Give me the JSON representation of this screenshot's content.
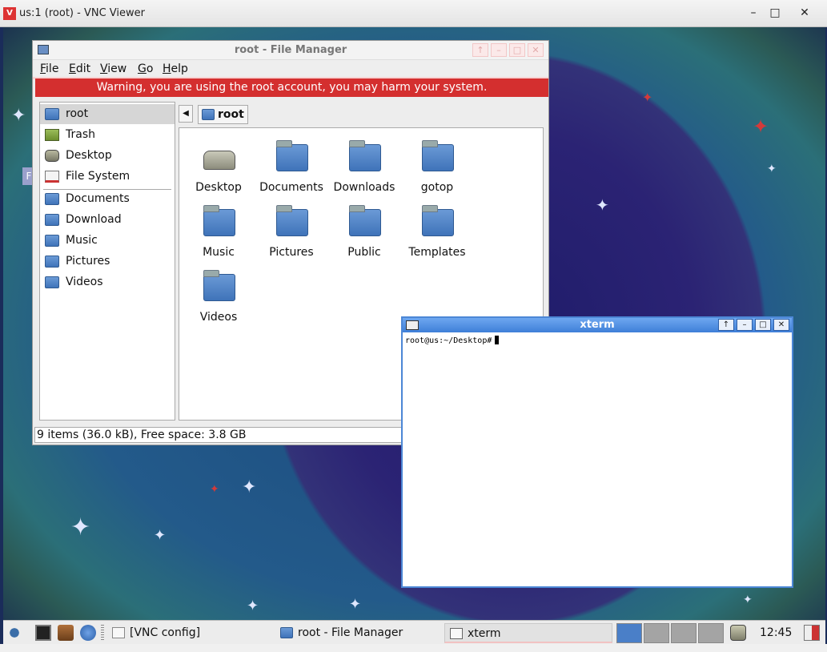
{
  "vnc": {
    "title": "us:1 (root) - VNC Viewer",
    "minimize": "–",
    "maximize": "□",
    "close": "✕"
  },
  "desktop": {
    "edge_tab_label": "F"
  },
  "file_manager": {
    "title": "root - File Manager",
    "buttons": {
      "up": "↑",
      "minimize": "–",
      "maximize": "□",
      "close": "✕"
    },
    "menu": [
      {
        "label": "File",
        "mnemonic": "F",
        "rest": "ile"
      },
      {
        "label": "Edit",
        "mnemonic": "E",
        "rest": "dit"
      },
      {
        "label": "View",
        "mnemonic": "V",
        "rest": "iew"
      },
      {
        "label": "Go",
        "mnemonic": "G",
        "rest": "o"
      },
      {
        "label": "Help",
        "mnemonic": "H",
        "rest": "elp"
      }
    ],
    "warning": "Warning, you are using the root account, you may harm your system.",
    "sidebar": {
      "places": [
        {
          "label": "root",
          "icon": "home-folder-icon",
          "selected": true
        },
        {
          "label": "Trash",
          "icon": "trash-icon",
          "selected": false
        },
        {
          "label": "Desktop",
          "icon": "desktop-icon",
          "selected": false
        },
        {
          "label": "File System",
          "icon": "drive-icon",
          "selected": false
        }
      ],
      "bookmarks": [
        {
          "label": "Documents",
          "icon": "folder-icon"
        },
        {
          "label": "Download",
          "icon": "folder-icon"
        },
        {
          "label": "Music",
          "icon": "folder-icon"
        },
        {
          "label": "Pictures",
          "icon": "folder-icon"
        },
        {
          "label": "Videos",
          "icon": "folder-icon"
        }
      ]
    },
    "path": {
      "back": "◀",
      "crumb": "root"
    },
    "files": [
      {
        "label": "Desktop",
        "icon": "desktop-drive-icon"
      },
      {
        "label": "Documents",
        "icon": "folder-icon"
      },
      {
        "label": "Downloads",
        "icon": "folder-icon"
      },
      {
        "label": "gotop",
        "icon": "folder-icon"
      },
      {
        "label": "Music",
        "icon": "folder-icon"
      },
      {
        "label": "Pictures",
        "icon": "folder-icon"
      },
      {
        "label": "Public",
        "icon": "folder-icon"
      },
      {
        "label": "Templates",
        "icon": "folder-icon"
      },
      {
        "label": "Videos",
        "icon": "folder-icon"
      }
    ],
    "status": "9 items (36.0 kB), Free space: 3.8 GB"
  },
  "xterm": {
    "title": "xterm",
    "buttons": {
      "up": "↑",
      "minimize": "–",
      "maximize": "□",
      "close": "✕"
    },
    "prompt": "root@us:~/Desktop#"
  },
  "taskbar": {
    "vnc_config": "[VNC config]",
    "tasks": [
      {
        "label": "root - File Manager",
        "active": false
      },
      {
        "label": "xterm",
        "active": true
      }
    ],
    "clock": "12:45"
  },
  "colors": {
    "warning_bg": "#d42f2f",
    "xterm_titlebar": "#3e7fd8",
    "pager_current": "#4a7fc8"
  }
}
